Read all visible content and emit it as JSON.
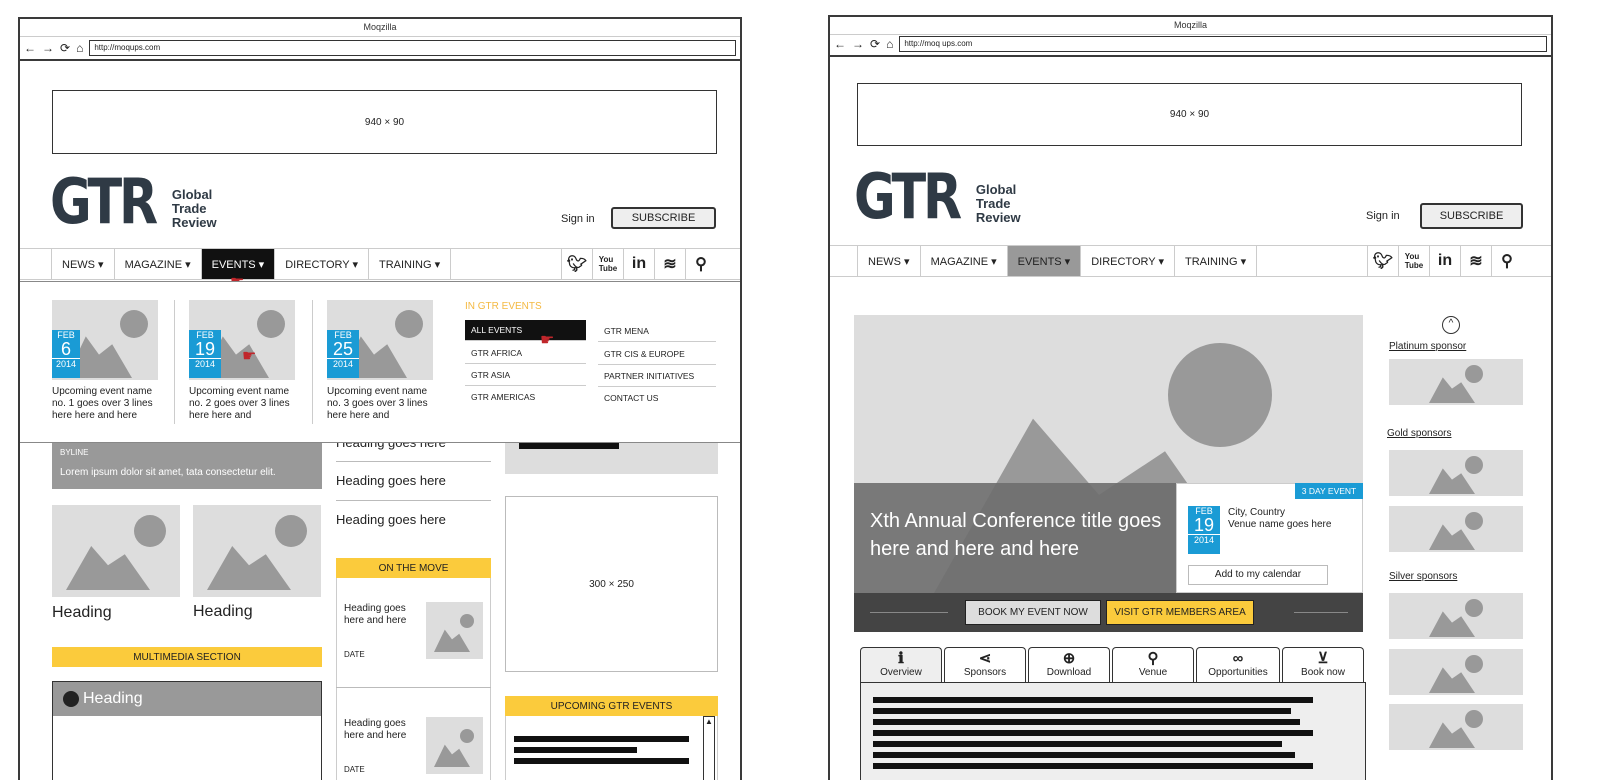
{
  "left": {
    "window_title": "Moqzilla",
    "url": "http://moqups.com",
    "ad_top": "940 × 90",
    "logo": {
      "main": "GTR",
      "line1": "Global",
      "line2": "Trade",
      "line3": "Review"
    },
    "sign_in": "Sign in",
    "subscribe": "SUBSCRIBE",
    "nav": [
      "NEWS ▾",
      "MAGAZINE ▾",
      "EVENTS ▾",
      "DIRECTORY ▾",
      "TRAINING ▾"
    ],
    "social": [
      "twitter-icon",
      "youtube-icon",
      "linkedin-icon",
      "rss-icon",
      "search-icon"
    ],
    "events": [
      {
        "month": "FEB",
        "day": "6",
        "year": "2014",
        "text": "Upcoming event name no. 1 goes over 3 lines here here and here"
      },
      {
        "month": "FEB",
        "day": "19",
        "year": "2014",
        "text": "Upcoming event name no. 2 goes over 3 lines here here and"
      },
      {
        "month": "FEB",
        "day": "25",
        "year": "2014",
        "text": "Upcoming event name no. 3 goes over 3 lines here here and"
      }
    ],
    "in_gtr_events": "IN GTR EVENTS",
    "dd_col1": [
      "ALL EVENTS",
      "GTR AFRICA",
      "GTR ASIA",
      "GTR AMERICAS"
    ],
    "dd_col2": [
      "GTR MENA",
      "GTR CIS & EUROPE",
      "PARTNER INITIATIVES",
      "CONTACT US"
    ],
    "byline": "BYLINE",
    "lorem": "Lorem ipsum dolor sit amet, tata consectetur elit.",
    "headings_list": [
      "Heading goes here",
      "Heading goes here",
      "Heading goes here"
    ],
    "heading1": "Heading",
    "heading2": "Heading",
    "multimedia": "MULTIMEDIA SECTION",
    "media_heading": "Heading",
    "on_the_move": "ON THE MOVE",
    "move_items": [
      {
        "title": "Heading goes here and here",
        "date": "DATE"
      },
      {
        "title": "Heading goes here and here",
        "date": "DATE"
      }
    ],
    "ad_side": "300 × 250",
    "upcoming": "UPCOMING GTR EVENTS"
  },
  "right": {
    "window_title": "Moqzilla",
    "url": "http://moq ups.com",
    "ad_top": "940 × 90",
    "logo": {
      "main": "GTR",
      "line1": "Global",
      "line2": "Trade",
      "line3": "Review"
    },
    "sign_in": "Sign in",
    "subscribe": "SUBSCRIBE",
    "nav": [
      "NEWS ▾",
      "MAGAZINE ▾",
      "EVENTS ▾",
      "DIRECTORY ▾",
      "TRAINING ▾"
    ],
    "hero_title": "Xth Annual Conference title goes here and here and here",
    "event_badge": "3 DAY EVENT",
    "date": {
      "month": "FEB",
      "day": "19",
      "year": "2014"
    },
    "location": "City, Country",
    "venue": "Venue name goes here",
    "add_calendar": "Add to my calendar",
    "book_btn": "BOOK MY EVENT NOW",
    "members_btn": "VISIT GTR MEMBERS AREA",
    "tabs": [
      {
        "icon": "info-icon",
        "glyph": "ℹ",
        "label": "Overview"
      },
      {
        "icon": "share-icon",
        "glyph": "⋖",
        "label": "Sponsors"
      },
      {
        "icon": "download-icon",
        "glyph": "⊕",
        "label": "Download"
      },
      {
        "icon": "pin-icon",
        "glyph": "⚲",
        "label": "Venue"
      },
      {
        "icon": "link-icon",
        "glyph": "∞",
        "label": "Opportunities"
      },
      {
        "icon": "cart-icon",
        "glyph": "⊻",
        "label": "Book now"
      }
    ],
    "sponsors": [
      "Platinum sponsor",
      "Gold sponsors",
      "Silver sponsors"
    ]
  }
}
